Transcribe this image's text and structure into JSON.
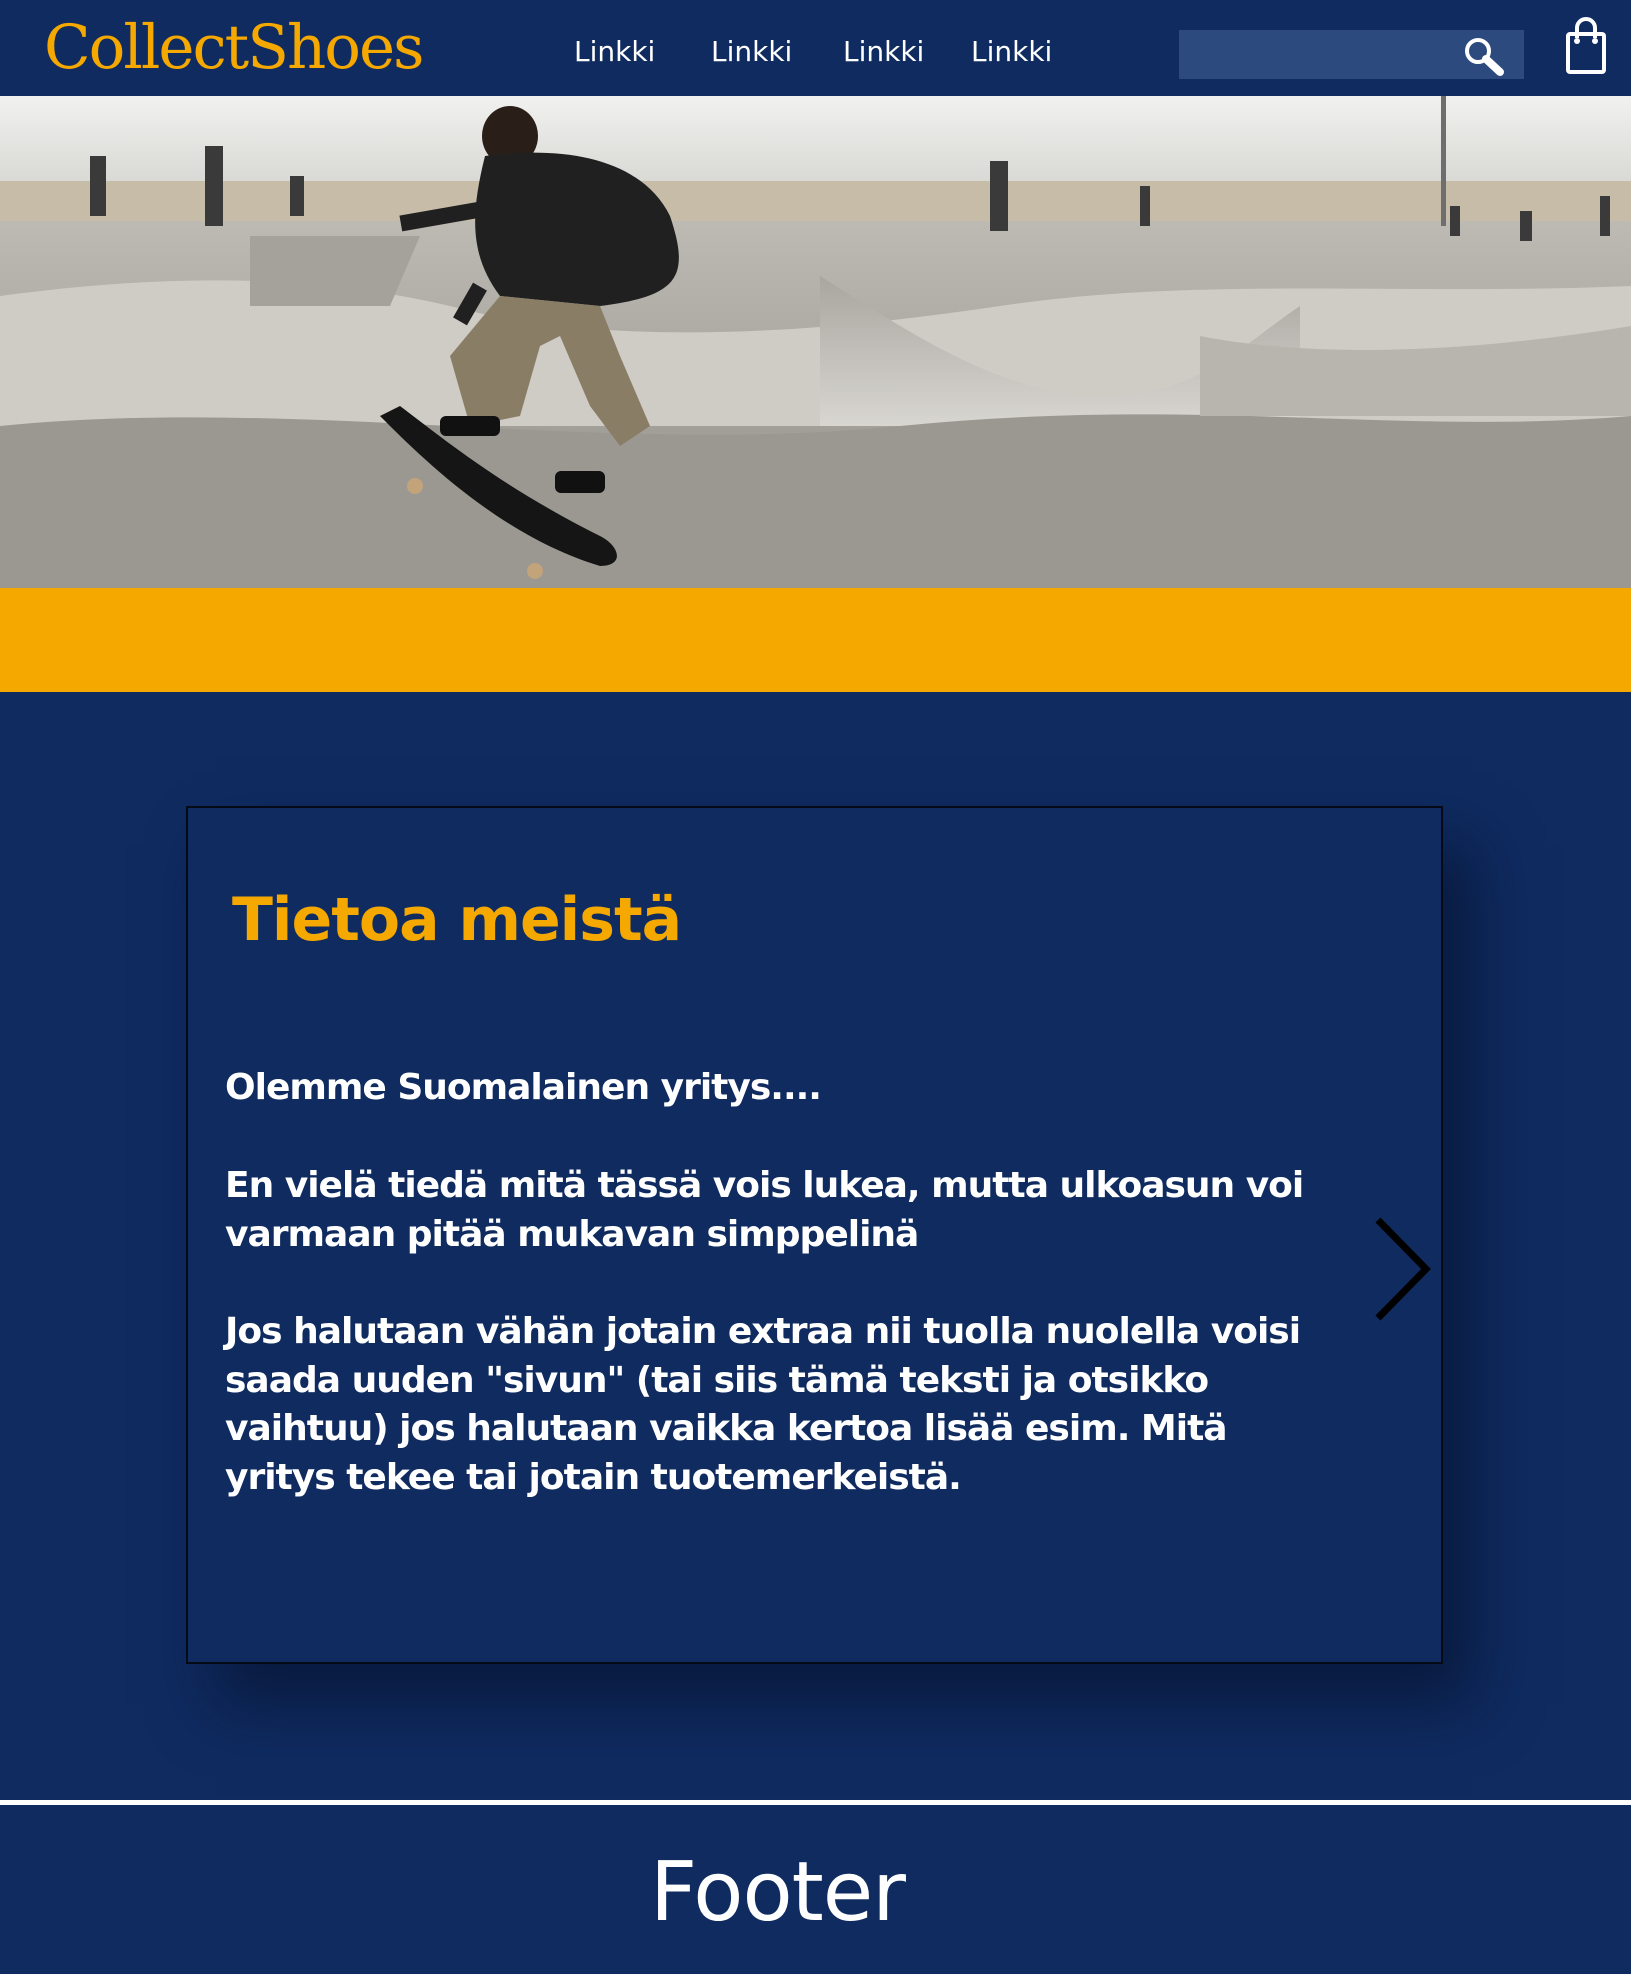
{
  "header": {
    "logo": "CollectShoes",
    "nav": [
      "Linkki",
      "Linkki",
      "Linkki",
      "Linkki"
    ],
    "search": {
      "value": "",
      "placeholder": "",
      "icon": "search-icon"
    },
    "cart": {
      "icon": "shopping-bag-icon"
    }
  },
  "hero": {
    "image": "skateboarder-skatepark-photo"
  },
  "about": {
    "title": "Tietoa meistä",
    "paragraphs": [
      "Olemme Suomalainen yritys....",
      "En vielä tiedä mitä tässä vois lukea, mutta ulkoasun voi varmaan pitää mukavan simppelinä",
      "Jos halutaan vähän jotain extraa nii tuolla nuolella voisi saada uuden \"sivun\" (tai siis tämä teksti ja otsikko vaihtuu) jos halutaan vaikka kertoa lisää esim. Mitä yritys tekee tai jotain tuotemerkeistä."
    ],
    "next_icon": "chevron-right-icon"
  },
  "footer": {
    "text": "Footer"
  },
  "colors": {
    "navy": "#0f2b60",
    "accent": "#f5a800",
    "search_bg": "#2d4a7f",
    "text": "#ffffff"
  }
}
